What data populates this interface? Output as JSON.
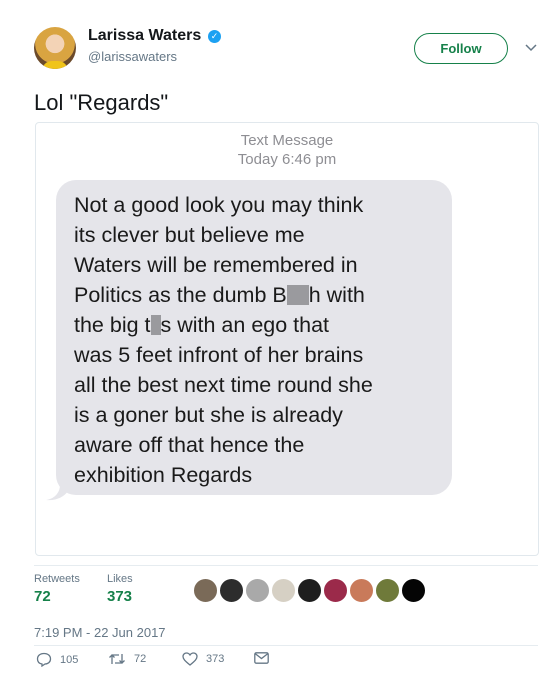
{
  "user": {
    "display_name": "Larissa Waters",
    "handle": "@larissawaters",
    "verified_icon": "verified-badge-icon"
  },
  "follow_label": "Follow",
  "tweet_text": "Lol \"Regards\"",
  "media": {
    "sms_title": "Text Message",
    "sms_time": "Today 6:46 pm",
    "message_lines": [
      "Not a good look you may think",
      "its clever but believe me",
      "Waters will be remembered in",
      "Politics as  the dumb B",
      "h with",
      "the big t",
      "s with an ego that",
      "was 5 feet infront of her brains",
      "all the best next time round she",
      "is a goner but she is already",
      "aware off that hence the",
      "exhibition Regards"
    ]
  },
  "stats": {
    "retweets_label": "Retweets",
    "retweets_count": "72",
    "likes_label": "Likes",
    "likes_count": "373"
  },
  "timestamp": "7:19 PM - 22 Jun 2017",
  "actions": {
    "reply_count": "105",
    "retweet_count": "72",
    "like_count": "373"
  },
  "colors": {
    "accent": "#16814a",
    "bubble": "#e5e5ea",
    "muted": "#657786"
  }
}
